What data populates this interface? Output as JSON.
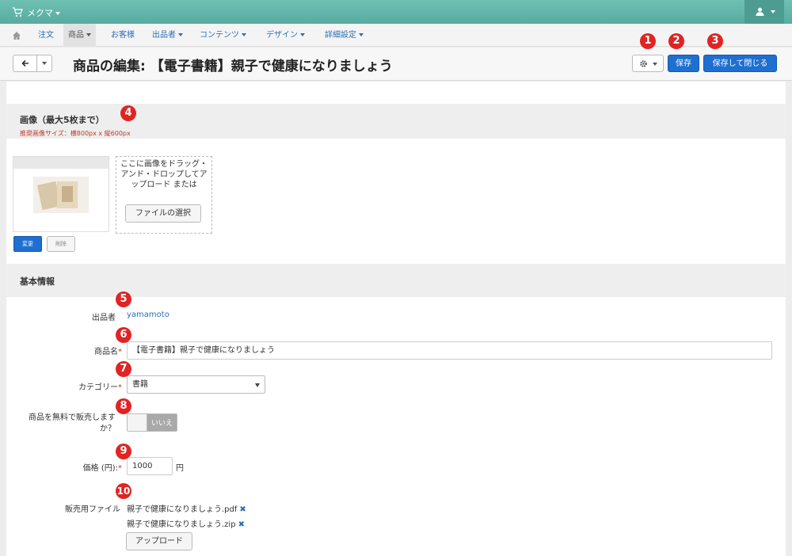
{
  "topbar": {
    "brand": "メクマ"
  },
  "nav": {
    "items": [
      {
        "label": "注文"
      },
      {
        "label": "商品"
      },
      {
        "label": "お客様"
      },
      {
        "label": "出品者"
      },
      {
        "label": "コンテンツ"
      },
      {
        "label": "デザイン"
      },
      {
        "label": "詳細設定"
      }
    ]
  },
  "header": {
    "title": "商品の編集: 【電子書籍】親子で健康になりましょう",
    "save_label": "保存",
    "save_close_label": "保存して閉じる"
  },
  "images_section": {
    "title": "画像（最大5枚まで）",
    "hint": "推奨画像サイズ：横800px x 縦600px",
    "dropzone_text_1": "ここに画像をドラッグ・",
    "dropzone_text_2": "アンド・ドロップしてア",
    "dropzone_text_3": "ップロード または",
    "choose_file_label": "ファイルの選択",
    "change_label": "変更",
    "delete_label": "削除"
  },
  "basic_section": {
    "title": "基本情報",
    "seller_label": "出品者",
    "seller_value": "yamamoto",
    "name_label": "商品名",
    "name_value": "【電子書籍】親子で健康になりましょう",
    "category_label": "カテゴリー",
    "category_value": "書籍",
    "free_label_1": "商品を無料で販売します",
    "free_label_2": "か？",
    "free_value": "いいえ",
    "price_label": "価格 (円):",
    "price_value": "1000",
    "price_unit": "円",
    "files_label": "販売用ファイル",
    "files": [
      "親子で健康になりましょう.pdf",
      "親子で健康になりましょう.zip"
    ],
    "upload_label": "アップロード"
  },
  "markers": [
    "1",
    "2",
    "3",
    "4",
    "5",
    "6",
    "7",
    "8",
    "9",
    "10"
  ],
  "colors": {
    "topbar": "#5cb3a6",
    "primary": "#1e6fd0",
    "marker": "#e02424",
    "required": "#c0392b",
    "link": "#2a6fb5"
  }
}
